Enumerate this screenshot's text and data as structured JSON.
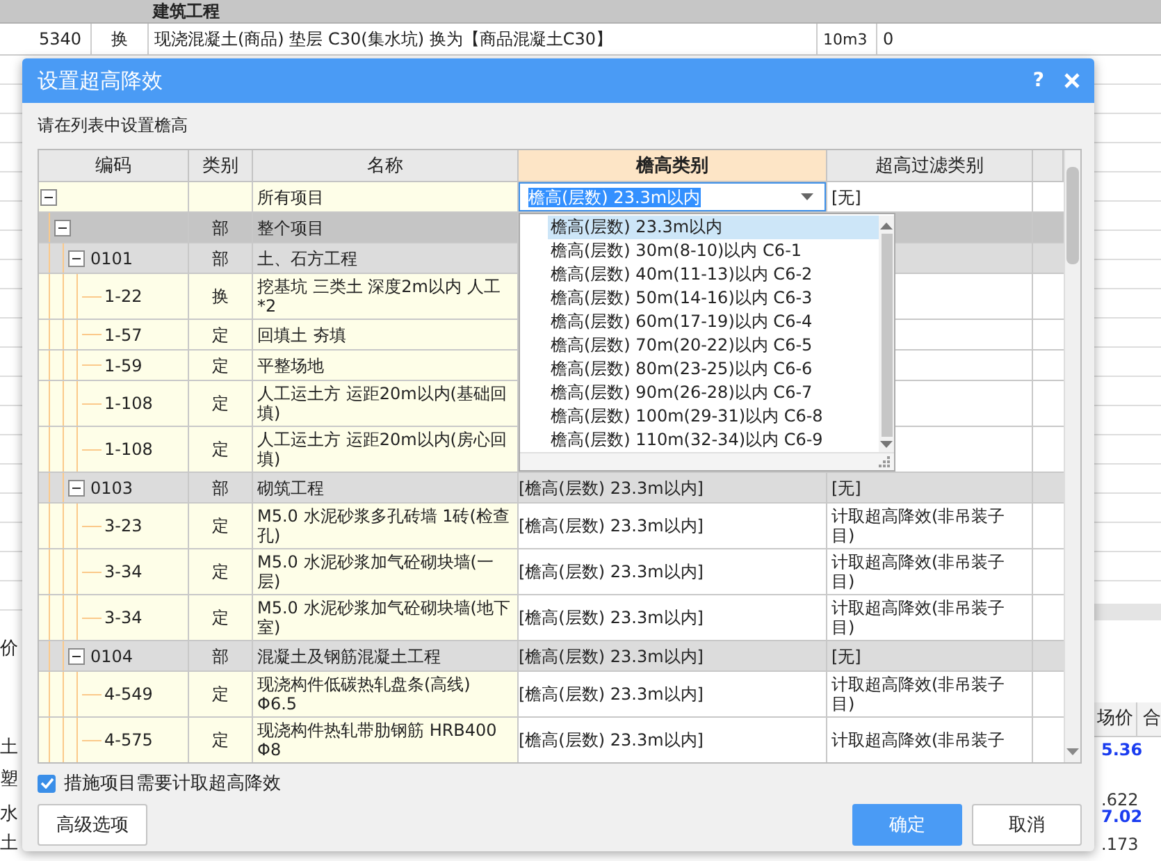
{
  "background": {
    "section_title": "建筑工程",
    "row": {
      "code": "5340",
      "type": "换",
      "name": "现浇混凝土(商品) 垫层 C30(集水坑)   换为【商品混凝土C30】",
      "unit": "10m3",
      "quantity": "0"
    },
    "left_fragments": [
      "价",
      "土",
      "塑",
      "水",
      "土"
    ],
    "right_headers": [
      "场价",
      "合"
    ],
    "right_values": [
      {
        "text": "5.36",
        "highlight": true
      },
      {
        "text": ".622",
        "highlight": false
      },
      {
        "text": "7.02",
        "highlight": true
      },
      {
        "text": ".173",
        "highlight": false
      }
    ]
  },
  "dialog": {
    "title": "设置超高降效",
    "help": "?",
    "instruction": "请在列表中设置檐高",
    "columns": [
      {
        "label": "编码",
        "selected": false
      },
      {
        "label": "类别",
        "selected": false
      },
      {
        "label": "名称",
        "selected": false
      },
      {
        "label": "檐高类别",
        "selected": true
      },
      {
        "label": "超高过滤类别",
        "selected": false
      }
    ],
    "rows": [
      {
        "kind": "all",
        "name": "所有项目",
        "expanded": true,
        "filter": "[无]",
        "eaves_editor": {
          "value": "檐高(层数) 23.3m以内",
          "options": [
            {
              "label": "檐高(层数) 23.3m以内",
              "selected": true
            },
            {
              "label": "檐高(层数) 30m(8-10)以内 C6-1",
              "selected": false
            },
            {
              "label": "檐高(层数) 40m(11-13)以内 C6-2",
              "selected": false
            },
            {
              "label": "檐高(层数) 50m(14-16)以内 C6-3",
              "selected": false
            },
            {
              "label": "檐高(层数) 60m(17-19)以内 C6-4",
              "selected": false
            },
            {
              "label": "檐高(层数) 70m(20-22)以内 C6-5",
              "selected": false
            },
            {
              "label": "檐高(层数) 80m(23-25)以内 C6-6",
              "selected": false
            },
            {
              "label": "檐高(层数) 90m(26-28)以内 C6-7",
              "selected": false
            },
            {
              "label": "檐高(层数) 100m(29-31)以内 C6-8",
              "selected": false
            },
            {
              "label": "檐高(层数) 110m(32-34)以内 C6-9",
              "selected": false
            }
          ]
        },
        "children": [
          {
            "kind": "group",
            "type": "部",
            "name": "整个项目",
            "expanded": true,
            "children": [
              {
                "kind": "group",
                "code": "0101",
                "type": "部",
                "name": "土、石方工程",
                "expanded": true,
                "children": [
                  {
                    "kind": "item",
                    "code": "1-22",
                    "type": "换",
                    "name": "挖基坑 三类土 深度2m以内  人工*2"
                  },
                  {
                    "kind": "item",
                    "code": "1-57",
                    "type": "定",
                    "name": "回填土 夯填"
                  },
                  {
                    "kind": "item",
                    "code": "1-59",
                    "type": "定",
                    "name": "平整场地"
                  },
                  {
                    "kind": "item",
                    "code": "1-108",
                    "type": "定",
                    "name": "人工运土方 运距20m以内(基础回填)"
                  },
                  {
                    "kind": "item",
                    "code": "1-108",
                    "type": "定",
                    "name": "人工运土方 运距20m以内(房心回填)"
                  }
                ]
              },
              {
                "kind": "group",
                "code": "0103",
                "type": "部",
                "name": "砌筑工程",
                "expanded": true,
                "eaves": "[檐高(层数) 23.3m以内]",
                "filter": "[无]",
                "children": [
                  {
                    "kind": "item",
                    "code": "3-23",
                    "type": "定",
                    "name": "M5.0 水泥砂浆多孔砖墙 1砖(检查孔)",
                    "eaves": "[檐高(层数) 23.3m以内]",
                    "filter": "计取超高降效(非吊装子目)"
                  },
                  {
                    "kind": "item",
                    "code": "3-34",
                    "type": "定",
                    "name": "M5.0 水泥砂浆加气砼砌块墙(一层)",
                    "eaves": "[檐高(层数) 23.3m以内]",
                    "filter": "计取超高降效(非吊装子目)"
                  },
                  {
                    "kind": "item",
                    "code": "3-34",
                    "type": "定",
                    "name": "M5.0 水泥砂浆加气砼砌块墙(地下室)",
                    "eaves": "[檐高(层数) 23.3m以内]",
                    "filter": "计取超高降效(非吊装子目)"
                  }
                ]
              },
              {
                "kind": "group",
                "code": "0104",
                "type": "部",
                "name": "混凝土及钢筋混凝土工程",
                "expanded": true,
                "eaves": "[檐高(层数) 23.3m以内]",
                "filter": "[无]",
                "children": [
                  {
                    "kind": "item",
                    "code": "4-549",
                    "type": "定",
                    "name": "现浇构件低碳热轧盘条(高线) Φ6.5",
                    "eaves": "[檐高(层数) 23.3m以内]",
                    "filter": "计取超高降效(非吊装子目)"
                  },
                  {
                    "kind": "item",
                    "code": "4-575",
                    "type": "定",
                    "name": "现浇构件热轧带肋钢筋 HRB400 Φ8",
                    "eaves": "[檐高(层数) 23.3m以内]",
                    "filter": "计取超高降效(非吊装子"
                  }
                ]
              }
            ]
          }
        ]
      }
    ],
    "measures_checkbox": {
      "label": "措施项目需要计取超高降效",
      "checked": true
    },
    "buttons": [
      {
        "label": "高级选项",
        "kind": "default"
      },
      {
        "label": "确定",
        "kind": "primary"
      },
      {
        "label": "取消",
        "kind": "default"
      }
    ]
  }
}
